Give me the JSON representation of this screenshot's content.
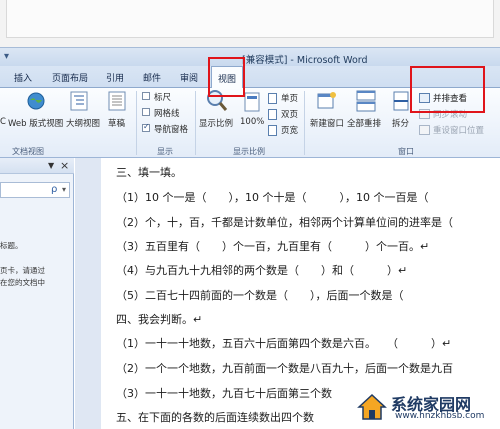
{
  "window": {
    "title": "[兼容模式] - Microsoft Word"
  },
  "tabs": [
    {
      "label": "插入"
    },
    {
      "label": "页面布局"
    },
    {
      "label": "引用"
    },
    {
      "label": "邮件"
    },
    {
      "label": "审阅"
    },
    {
      "label": "视图",
      "active": true
    }
  ],
  "ribbon": {
    "document_views": {
      "group_label": "文档视图",
      "web_layout": "Web 版式视图",
      "outline": "大纲视图",
      "draft": "草稿",
      "partial_left": "C"
    },
    "show": {
      "group_label": "显示",
      "ruler": {
        "label": "标尺",
        "checked": false
      },
      "gridlines": {
        "label": "网格线",
        "checked": false
      },
      "nav_pane": {
        "label": "导航窗格",
        "checked": true
      }
    },
    "zoom": {
      "group_label": "显示比例",
      "zoom": "显示比例",
      "hundred": "100%",
      "one_page": "单页",
      "two_pages": "双页",
      "page_width": "页宽"
    },
    "window": {
      "group_label": "窗口",
      "new_window": "新建窗口",
      "arrange_all": "全部重排",
      "split": "拆分",
      "side_by_side": "并排查看",
      "sync_scroll": "同步滚动",
      "reset_position": "重设窗口位置"
    }
  },
  "nav_pane": {
    "close": "×",
    "dropdown": "▼",
    "search_icon_glyph": "ρ",
    "search_dropdown": "▾",
    "text_lines": [
      "标题。",
      "页卡，请通过",
      "在您的文档中"
    ]
  },
  "document": {
    "lines": [
      "三、填一填。",
      "（1）10 个一是（　　），10 个十是（　　　），10 个一百是（",
      "（2）个，十，百，千都是计数单位，相邻两个计算单位间的进率是（",
      "（3）五百里有（　　）个一百，九百里有（　　　）个一百。↵",
      "（4）与九百九十九相邻的两个数是（　　）和（　　　）↵",
      "（5）二百七十四前面的一个数是（　　），后面一个数是（",
      "四、我会判断。↵",
      "（1）一十一十地数，五百六十后面第四个数是六百。　　（　　　）↵",
      "（2）一个一个地数，九百前面一个数是八百九十，后面一个数是九百",
      "（3）一十一十地数，九百七十后面第三个数",
      "五、在下面的各数的后面连续数出四个数"
    ]
  },
  "watermark": {
    "name": "系统家园网",
    "url": "www.hnzkhbsb.com"
  },
  "colors": {
    "highlight_red": "#e0141a",
    "ribbon_blue": "#c9d9ee"
  }
}
